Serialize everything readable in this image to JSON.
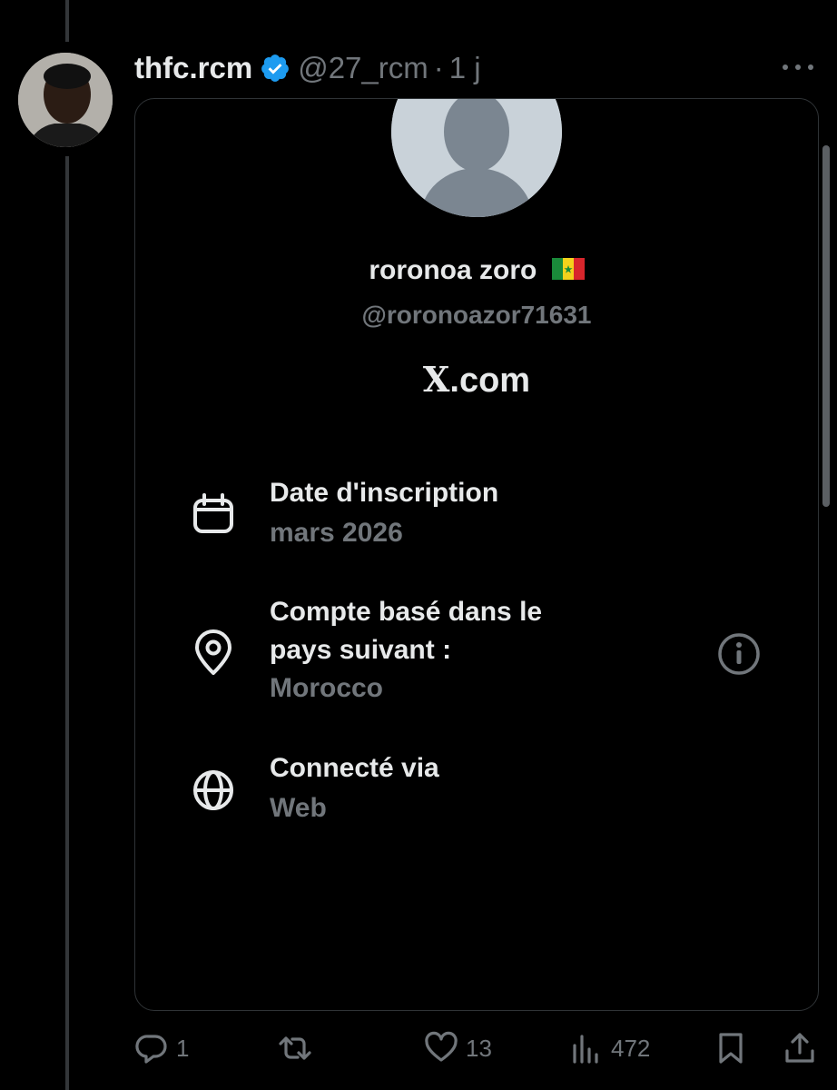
{
  "tweet": {
    "author_name": "thfc.rcm",
    "author_handle": "@27_rcm",
    "separator": "·",
    "time": "1 j"
  },
  "card": {
    "profile_name": "roronoa zoro",
    "profile_handle": "@roronoazor71631",
    "site": "X.com",
    "site_x": "X",
    "site_rest": ".com",
    "rows": [
      {
        "title": "Date d'inscription",
        "value": "mars 2026",
        "icon": "calendar-icon"
      },
      {
        "title_line1": "Compte basé dans le",
        "title_line2": "pays suivant :",
        "value": "Morocco",
        "icon": "location-pin-icon"
      },
      {
        "title": "Connecté via",
        "value": "Web",
        "icon": "globe-icon"
      }
    ]
  },
  "actions": {
    "replies": "1",
    "reposts": "",
    "likes": "13",
    "views": "472"
  },
  "colors": {
    "background": "#000000",
    "text_primary": "#e7e9ea",
    "text_secondary": "#71767b",
    "verified_blue": "#1d9bf0",
    "border": "#2f3336"
  }
}
